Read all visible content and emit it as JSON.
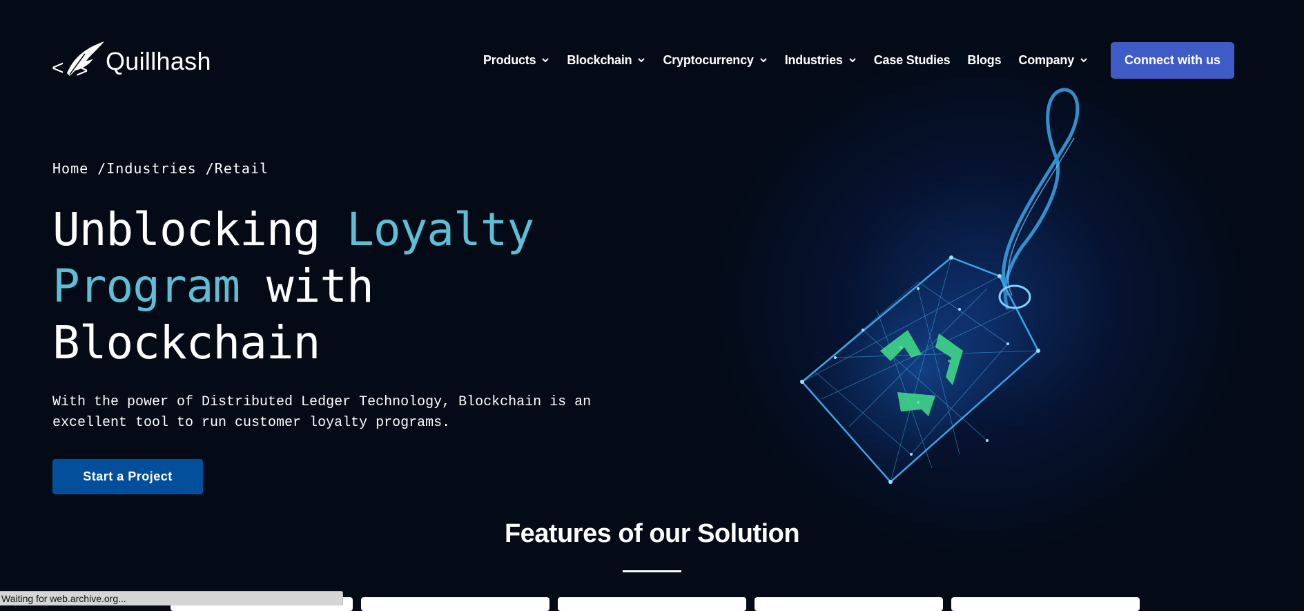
{
  "brand": {
    "name": "Quillhash"
  },
  "nav": {
    "items": [
      {
        "label": "Products",
        "has_dropdown": true
      },
      {
        "label": "Blockchain",
        "has_dropdown": true
      },
      {
        "label": "Cryptocurrency",
        "has_dropdown": true
      },
      {
        "label": "Industries",
        "has_dropdown": true
      },
      {
        "label": "Case Studies",
        "has_dropdown": false
      },
      {
        "label": "Blogs",
        "has_dropdown": false
      },
      {
        "label": "Company",
        "has_dropdown": true
      }
    ],
    "cta_label": "Connect with us"
  },
  "breadcrumb": {
    "home": "Home",
    "sep1": " /",
    "industries": "Industries",
    "sep2": " /",
    "current": "Retail"
  },
  "hero": {
    "headline_part1": "Unblocking ",
    "headline_accent": "Loyalty Program",
    "headline_part2": " with Blockchain",
    "description": "With the power of Distributed Ledger Technology, Blockchain is an excellent tool to run customer loyalty programs.",
    "button_label": "Start a Project"
  },
  "features": {
    "title": "Features of our Solution"
  },
  "status": {
    "text": "Waiting for web.archive.org..."
  },
  "icons": {
    "logo": "quill-code-logo-icon",
    "dropdown": "chevron-down-icon",
    "hero": "recycle-tag-icon"
  },
  "colors": {
    "background": "#040a16",
    "accent_text": "#5cbfd6",
    "cta": "#3f5bc6",
    "start_button": "#044f9b",
    "tag_glow": "#2a8fe0",
    "recycle": "#3fd68a"
  }
}
